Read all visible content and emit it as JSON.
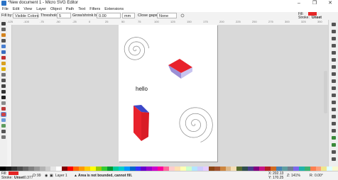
{
  "titlebar": {
    "title": "*New document 1 - Micro SVG Editor",
    "minimize": "–",
    "maximize": "❐",
    "close": "✕"
  },
  "menu": [
    "File",
    "Edit",
    "View",
    "Layer",
    "Object",
    "Path",
    "Text",
    "Filters",
    "Extensions"
  ],
  "controlbar": {
    "fill_by_label": "Fill by:",
    "fill_by_value": "Visible Colors",
    "threshold_label": "Threshold:",
    "threshold_value": "5",
    "grow_label": "Grow/shrink by:",
    "grow_value": "0.00",
    "unit": "mm",
    "close_gaps_label": "Close gaps:",
    "close_gaps_value": "None",
    "fill_label": "Fill:",
    "stroke_label": "Stroke:",
    "stroke_value": "Unset",
    "fill_color": "#e52626"
  },
  "ruler_marks": [
    "-125",
    "-100",
    "-75",
    "-50",
    "-25",
    "0",
    "25",
    "50",
    "75",
    "100",
    "125",
    "150",
    "175",
    "200",
    "225",
    "250",
    "275",
    "300",
    "325",
    "350"
  ],
  "canvas": {
    "text_object": "hello",
    "cube_front": "#e8222c",
    "cube_top": "#9b8fd6",
    "cube_side": "#3c48c8"
  },
  "palette": [
    "#000000",
    "#1a1a1a",
    "#333333",
    "#4d4d4d",
    "#666666",
    "#808080",
    "#999999",
    "#b3b3b3",
    "#cccccc",
    "#e6e6e6",
    "#ffffff",
    "#800000",
    "#ff0000",
    "#ff6600",
    "#ff9900",
    "#ffcc00",
    "#ffff00",
    "#99cc00",
    "#33cc33",
    "#009933",
    "#00cc99",
    "#00cccc",
    "#0099ff",
    "#0066cc",
    "#3333ff",
    "#6600cc",
    "#9900cc",
    "#cc00cc",
    "#ff0099",
    "#ff6699",
    "#ffcccc",
    "#ffe0b3",
    "#ffffb3",
    "#ccffcc",
    "#b3e6ff",
    "#ccccff",
    "#e6ccff",
    "#8b4513",
    "#a0522d",
    "#cd853f",
    "#deb887",
    "#f5deb3",
    "#556b2f",
    "#2f4f4f",
    "#483d8b",
    "#800080",
    "#c71585",
    "#b22222",
    "#d2691e",
    "#4682b4",
    "#5f9ea0",
    "#708090",
    "#7b68ee",
    "#20b2aa",
    "#3cb371",
    "#ff7f50",
    "#ffa07a",
    "#f0e68c",
    "#e0ffff",
    "#fafad2"
  ],
  "status": {
    "fill_label": "Fill:",
    "stroke_label": "Stroke:",
    "stroke_value": "Unset",
    "stroke_width": "0.377",
    "opacity_label": "O:",
    "opacity_value": "99",
    "layer": "Layer 1",
    "message": "Area is not bounded, cannot fill.",
    "x_label": "X:",
    "x_value": "202.13",
    "y_label": "Y:",
    "y_value": "170.25",
    "zoom_label": "Z:",
    "zoom_value": "141%",
    "rotation_label": "R:",
    "rotation_value": "0.00°"
  }
}
